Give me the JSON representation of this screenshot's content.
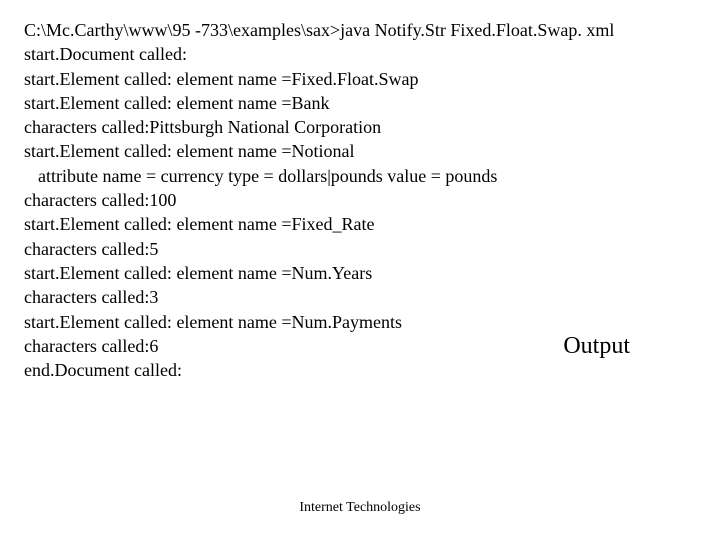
{
  "console": {
    "lines": [
      "C:\\Mc.Carthy\\www\\95 -733\\examples\\sax>java Notify.Str Fixed.Float.Swap. xml",
      "start.Document called:",
      "start.Element called: element name =Fixed.Float.Swap",
      "start.Element called: element name =Bank",
      "characters called:Pittsburgh National Corporation",
      "start.Element called: element name =Notional",
      "  attribute name = currency  type = dollars|pounds value = pounds",
      "characters called:100",
      "start.Element called: element name =Fixed_Rate",
      "characters called:5",
      "start.Element called: element name =Num.Years",
      "characters called:3",
      "start.Element called: element name =Num.Payments",
      "characters called:6",
      "end.Document called:"
    ]
  },
  "label": "Output",
  "footer": "Internet Technologies"
}
